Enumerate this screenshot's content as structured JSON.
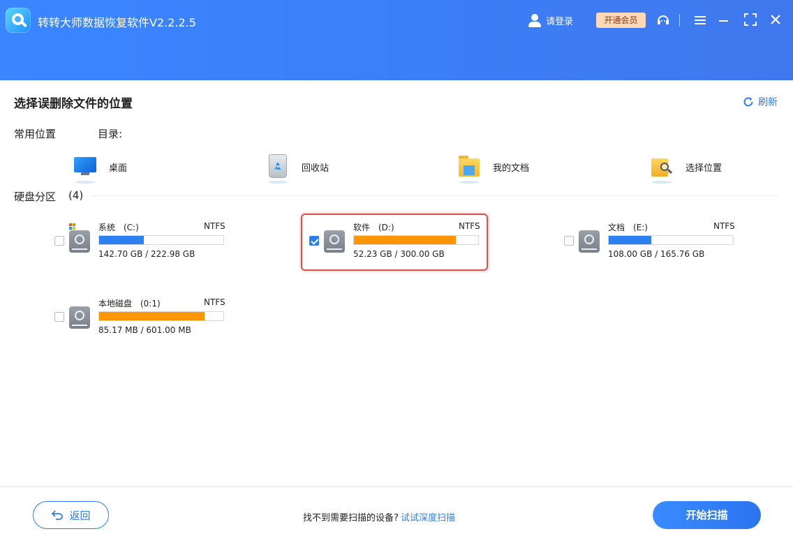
{
  "app": {
    "title": "转转大师数据恢复软件V2.2.2.5"
  },
  "header": {
    "login_label": "请登录",
    "vip_label": "开通会员"
  },
  "main": {
    "title": "选择误删除文件的位置",
    "refresh_label": "刷新",
    "common_label": "常用位置",
    "dir_label": "目录:",
    "locations": [
      {
        "label": "桌面",
        "icon": "desktop-icon"
      },
      {
        "label": "回收站",
        "icon": "recycle-bin-icon"
      },
      {
        "label": "我的文档",
        "icon": "documents-folder-icon"
      },
      {
        "label": "选择位置",
        "icon": "folder-search-icon"
      }
    ],
    "disk_section_label": "硬盘分区",
    "disk_count": "(4)",
    "drives": [
      {
        "name": "系统　(C:)",
        "fs": "NTFS",
        "size": "142.70 GB / 222.98 GB",
        "used_fraction": 0.36,
        "checked": false,
        "bar_color": "#2e80f0",
        "system": true
      },
      {
        "name": "软件　(D:)",
        "fs": "NTFS",
        "size": "52.23 GB / 300.00 GB",
        "used_fraction": 0.82,
        "checked": true,
        "bar_color": "#ff9500",
        "system": false
      },
      {
        "name": "文档　(E:)",
        "fs": "NTFS",
        "size": "108.00 GB / 165.76 GB",
        "used_fraction": 0.34,
        "checked": false,
        "bar_color": "#2e80f0",
        "system": false
      },
      {
        "name": "本地磁盘　(0:1)",
        "fs": "NTFS",
        "size": "85.17 MB / 601.00 MB",
        "used_fraction": 0.85,
        "checked": false,
        "bar_color": "#ff9500",
        "system": false
      }
    ]
  },
  "footer": {
    "back_label": "返回",
    "hint_text": "找不到需要扫描的设备?",
    "deep_scan_label": "试试深度扫描",
    "start_label": "开始扫描"
  },
  "colors": {
    "accent": "#2d7cf0",
    "header": "#3a86ff",
    "used_orange": "#ff9500",
    "used_blue": "#2e80f0",
    "highlight": "#d9534f"
  }
}
